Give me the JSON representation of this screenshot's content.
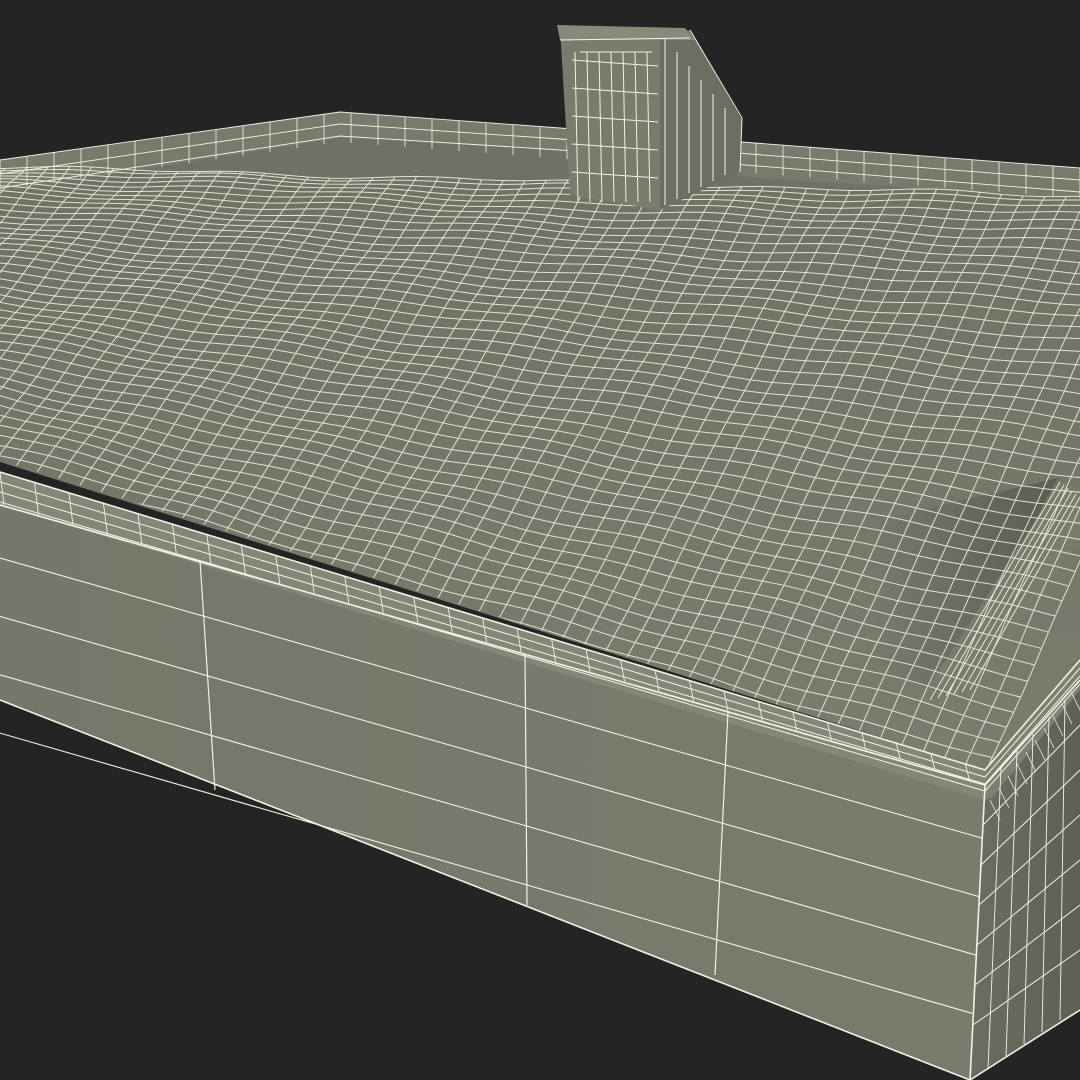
{
  "viewport": {
    "background_color": "#242424",
    "shading_color": "#7d7e70",
    "wire_color": "#f4f1e3",
    "wireframe_overlay": true
  },
  "model": {
    "parts": [
      "roof-surface",
      "parapet-wall",
      "front-wall",
      "right-wall",
      "roof-access-hatch"
    ]
  }
}
